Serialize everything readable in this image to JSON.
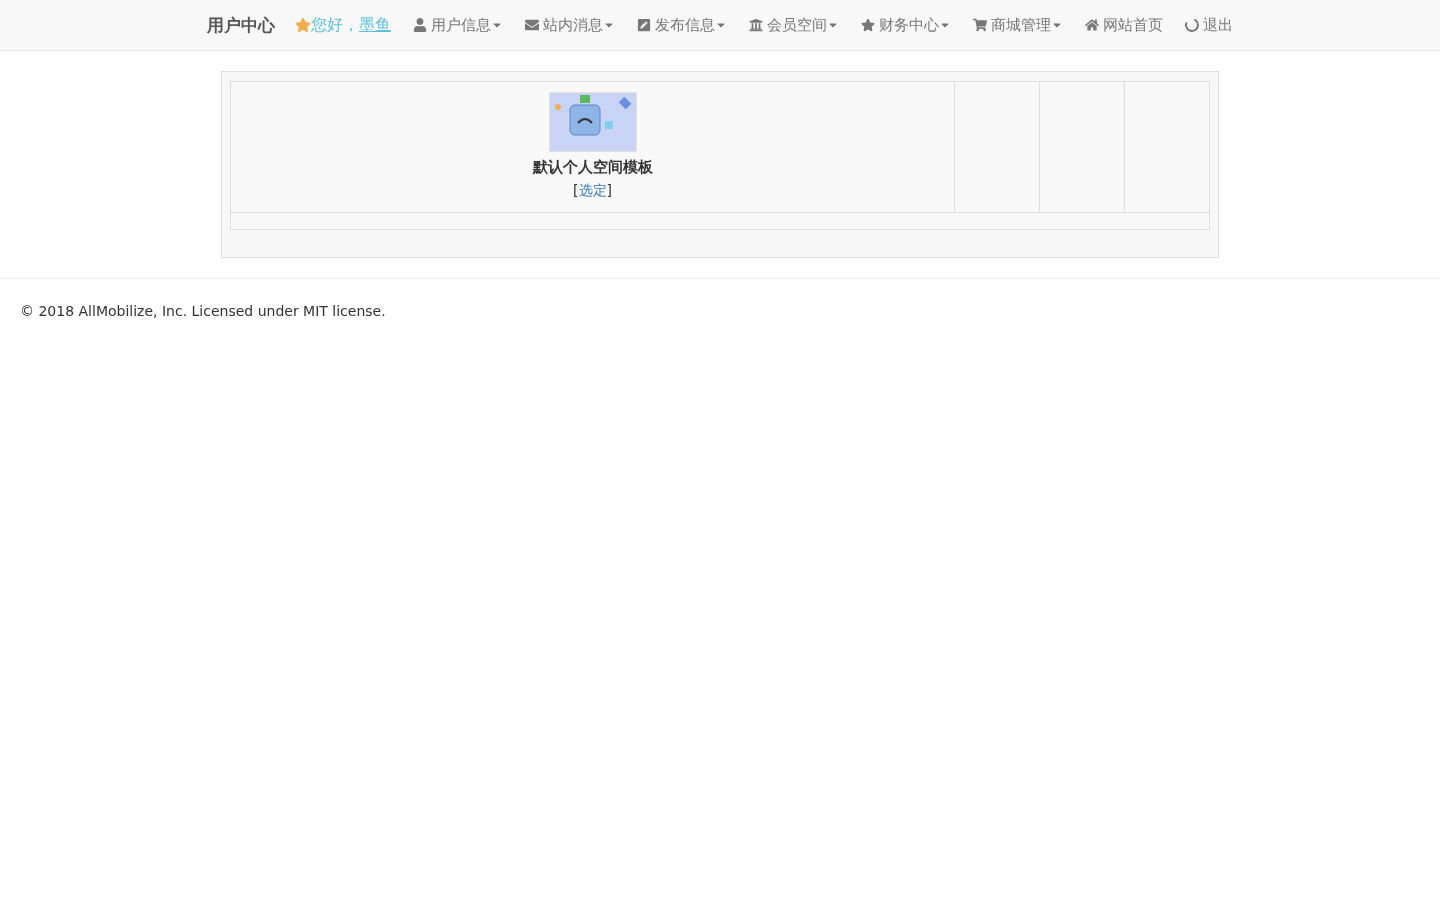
{
  "navbar": {
    "brand": "用户中心",
    "greeting": {
      "text": "您好，",
      "name": "墨鱼"
    },
    "items": [
      {
        "label": "用户信息",
        "has_menu": true
      },
      {
        "label": "站内消息",
        "has_menu": true
      },
      {
        "label": "发布信息",
        "has_menu": true
      },
      {
        "label": "会员空间",
        "has_menu": true
      },
      {
        "label": "财务中心",
        "has_menu": true
      },
      {
        "label": "商城管理",
        "has_menu": true
      },
      {
        "label": "网站首页",
        "has_menu": false
      },
      {
        "label": "退出",
        "has_menu": false
      }
    ]
  },
  "templates": [
    {
      "title": "默认个人空间模板",
      "action": {
        "open": "[",
        "label": "选定",
        "close": "]"
      }
    }
  ],
  "footer": "© 2018 AllMobilize, Inc. Licensed under MIT license."
}
